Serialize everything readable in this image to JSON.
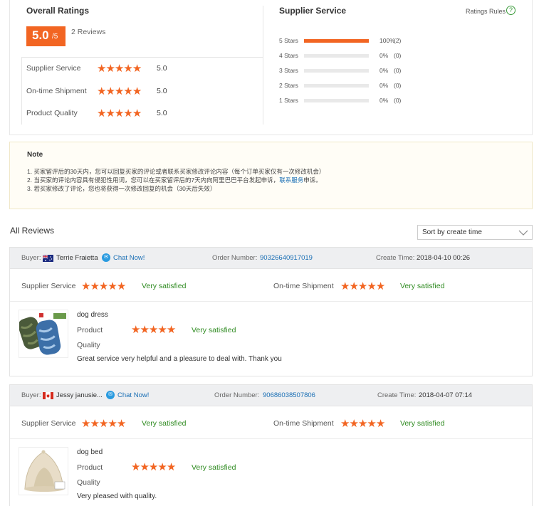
{
  "overall": {
    "title": "Overall Ratings",
    "score": "5.0",
    "score_suffix": "/5",
    "reviews_count": "2 Reviews",
    "dimensions": [
      {
        "label": "Supplier Service",
        "stars": 5,
        "value": "5.0"
      },
      {
        "label": "On-time Shipment",
        "stars": 5,
        "value": "5.0"
      },
      {
        "label": "Product Quality",
        "stars": 5,
        "value": "5.0"
      }
    ]
  },
  "supplier_service": {
    "title": "Supplier Service",
    "rules_label": "Ratings Rules",
    "rules_icon": "question-circle-icon",
    "bars": [
      {
        "label": "5 Stars",
        "fraction": 1.0,
        "percent": "100%",
        "count": "(2)"
      },
      {
        "label": "4 Stars",
        "fraction": 0,
        "percent": "0%",
        "count": "(0)"
      },
      {
        "label": "3 Stars",
        "fraction": 0,
        "percent": "0%",
        "count": "(0)"
      },
      {
        "label": "2 Stars",
        "fraction": 0,
        "percent": "0%",
        "count": "(0)"
      },
      {
        "label": "1 Stars",
        "fraction": 0,
        "percent": "0%",
        "count": "(0)"
      }
    ]
  },
  "note": {
    "title": "Note",
    "line1": "1. 买家留评后的30天内，您可以回复买家的评论或者联系买家修改评论内容（每个订单买家仅有一次修改机会）",
    "line2_before": "2. 当买家的评论内容具有侵犯性用词，您可以在买家留评后的7天内向阿里巴巴平台发起申诉，",
    "line2_link": "联系服务",
    "line2_after": "申诉。",
    "line3": "3. 若买家修改了评论，您也将获得一次修改回复的机会（30天后失效）"
  },
  "reviews_section": {
    "title": "All Reviews",
    "sort_label": "Sort by create time"
  },
  "reviews": [
    {
      "buyer_label": "Buyer:",
      "buyer_name": "Terrie Fraietta",
      "flag": "australia-flag-icon",
      "chat_label": "Chat Now!",
      "order_label": "Order Number:",
      "order_number": "90326640917019",
      "time_label": "Create Time:",
      "create_time": "2018-04-10 00:26",
      "supplier_service_label": "Supplier Service",
      "supplier_service_stars": 5,
      "supplier_service_text": "Very satisfied",
      "shipment_label": "On-time Shipment",
      "shipment_stars": 5,
      "shipment_text": "Very satisfied",
      "product_name": "dog dress",
      "product_quality_label_1": "Product",
      "product_quality_label_2": "Quality",
      "product_quality_stars": 5,
      "product_quality_text": "Very satisfied",
      "comment": "Great service very helpful and a pleasure to deal with. Thank you"
    },
    {
      "buyer_label": "Buyer:",
      "buyer_name": "Jessy janusie...",
      "flag": "canada-flag-icon",
      "chat_label": "Chat Now!",
      "order_label": "Order Number:",
      "order_number": "90686038507806",
      "time_label": "Create Time:",
      "create_time": "2018-04-07 07:14",
      "supplier_service_label": "Supplier Service",
      "supplier_service_stars": 5,
      "supplier_service_text": "Very satisfied",
      "shipment_label": "On-time Shipment",
      "shipment_stars": 5,
      "shipment_text": "Very satisfied",
      "product_name": "dog bed",
      "product_quality_label_1": "Product",
      "product_quality_label_2": "Quality",
      "product_quality_stars": 5,
      "product_quality_text": "Very satisfied",
      "comment": "Very pleased with quality."
    }
  ],
  "colors": {
    "accent": "#f26522",
    "satisfied": "#2d8a1f",
    "link": "#1a6fb5"
  }
}
